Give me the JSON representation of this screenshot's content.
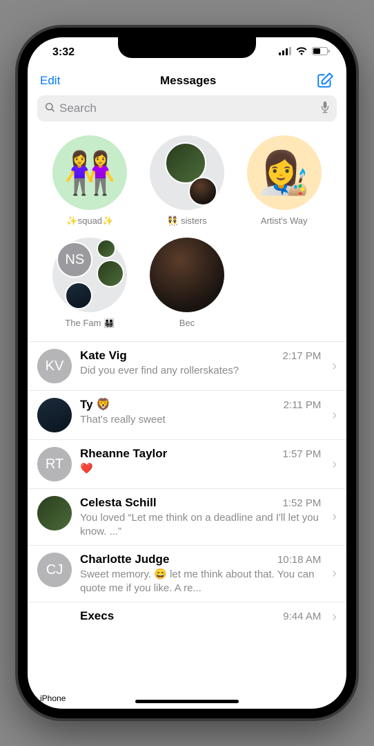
{
  "status": {
    "time": "3:32"
  },
  "header": {
    "edit": "Edit",
    "title": "Messages"
  },
  "search": {
    "placeholder": "Search"
  },
  "pinned": [
    {
      "label": "✨squad✨",
      "kind": "emoji",
      "emoji": "👭",
      "bg": "#c7ecc9"
    },
    {
      "label": "👯 sisters",
      "kind": "group-photo"
    },
    {
      "label": "Artist's Way",
      "kind": "emoji",
      "emoji": "👩‍🎨",
      "bg": "#ffe7b8"
    },
    {
      "label": "The Fam 👨‍👩‍👧‍👦",
      "kind": "group-initials",
      "initials": "NS"
    },
    {
      "label": "Bec",
      "kind": "photo"
    }
  ],
  "conversations": [
    {
      "name": "Kate Vig",
      "time": "2:17 PM",
      "preview": "Did you ever find any rollerskates?",
      "avatar": {
        "type": "initials",
        "text": "KV"
      }
    },
    {
      "name": "Ty 🦁",
      "time": "2:11 PM",
      "preview": "That's really sweet",
      "avatar": {
        "type": "photo"
      }
    },
    {
      "name": "Rheanne Taylor",
      "time": "1:57 PM",
      "preview": "❤️",
      "avatar": {
        "type": "initials",
        "text": "RT"
      }
    },
    {
      "name": "Celesta Schill",
      "time": "1:52 PM",
      "preview": "You loved “Let me think on a deadline and I'll let you know. ...”",
      "avatar": {
        "type": "photo"
      }
    },
    {
      "name": "Charlotte Judge",
      "time": "10:18 AM",
      "preview": "Sweet memory. 😄 let me think about that. You can quote me if you like. A re...",
      "avatar": {
        "type": "initials",
        "text": "CJ"
      }
    },
    {
      "name": "Execs",
      "time": "9:44 AM",
      "preview": "",
      "avatar": {
        "type": "initials",
        "text": ""
      }
    }
  ],
  "watermark": "iPhone"
}
